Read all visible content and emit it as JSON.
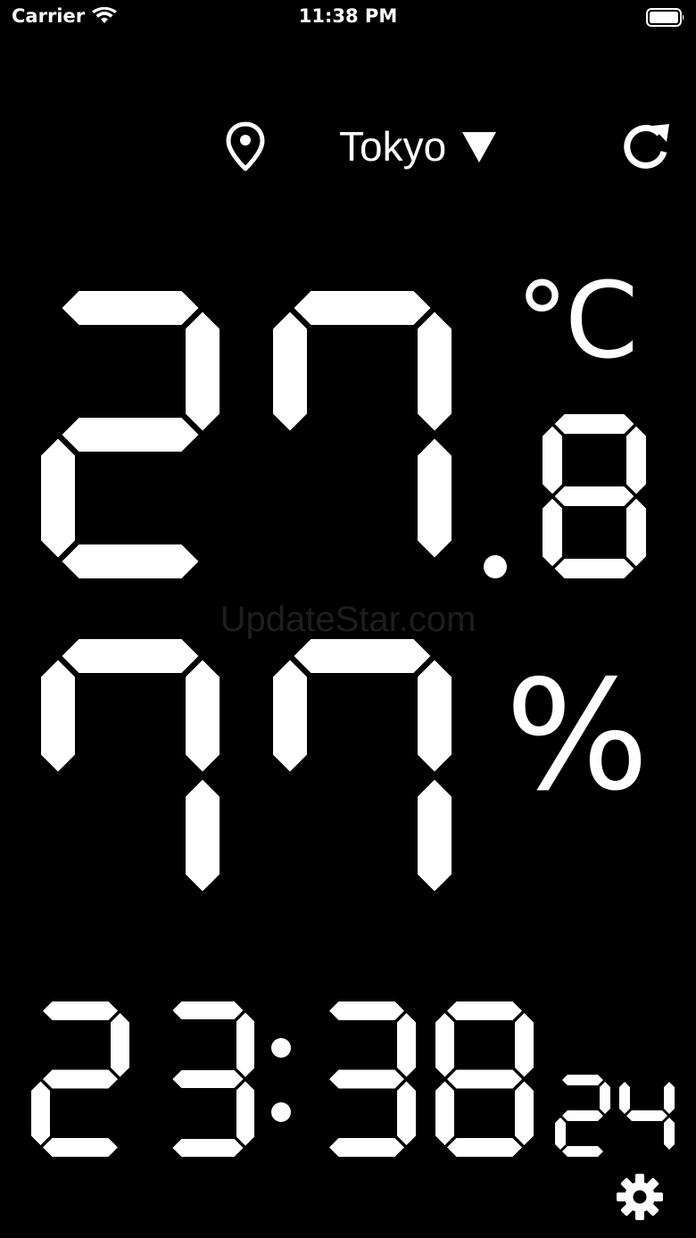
{
  "status_bar": {
    "carrier": "Carrier",
    "time": "11:38 PM",
    "icons": [
      "wifi-icon",
      "battery-icon"
    ]
  },
  "header": {
    "location_icon": "map-pin-icon",
    "city": "Tokyo",
    "dropdown_icon": "triangle-down-icon",
    "refresh_icon": "refresh-icon"
  },
  "temperature": {
    "integer": "27",
    "decimal": "8",
    "unit": "°C"
  },
  "humidity": {
    "value": "77",
    "unit": "%"
  },
  "clock": {
    "hours": "23",
    "minutes": "38",
    "seconds": "24"
  },
  "watermark": "UpdateStar.com",
  "footer": {
    "settings_icon": "gear-icon"
  },
  "colors": {
    "background": "#000000",
    "foreground": "#ffffff"
  }
}
